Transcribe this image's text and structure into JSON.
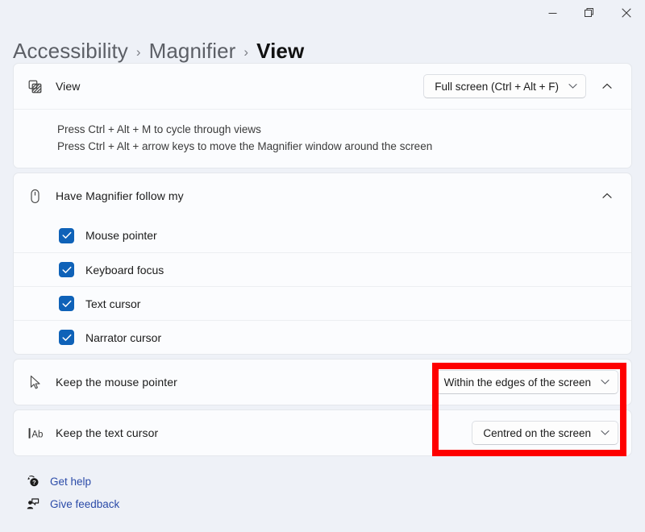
{
  "window": {
    "controls": [
      {
        "name": "minimize",
        "label": "Minimize"
      },
      {
        "name": "maximize",
        "label": "Restore"
      },
      {
        "name": "close",
        "label": "Close"
      }
    ]
  },
  "breadcrumb": {
    "items": [
      {
        "label": "Accessibility",
        "current": false
      },
      {
        "label": "Magnifier",
        "current": false
      },
      {
        "label": "View",
        "current": true
      }
    ],
    "separator": "›"
  },
  "view_card": {
    "icon": "view-layers-icon",
    "label": "View",
    "dropdown_value": "Full screen (Ctrl + Alt + F)",
    "collapse_icon": "chevron-up-icon",
    "description_lines": [
      "Press Ctrl + Alt + M to cycle through views",
      "Press Ctrl + Alt + arrow keys to move the Magnifier window around the screen"
    ]
  },
  "follow_card": {
    "icon": "mouse-icon",
    "label": "Have Magnifier follow my",
    "collapse_icon": "chevron-up-icon",
    "checkboxes": [
      {
        "label": "Mouse pointer",
        "checked": true
      },
      {
        "label": "Keyboard focus",
        "checked": true
      },
      {
        "label": "Text cursor",
        "checked": true
      },
      {
        "label": "Narrator cursor",
        "checked": true
      }
    ]
  },
  "pointer_card": {
    "icon": "mouse-pointer-icon",
    "label": "Keep the mouse pointer",
    "dropdown_value": "Within the edges of the screen"
  },
  "text_cursor_card": {
    "icon": "text-cursor-icon",
    "label": "Keep the text cursor",
    "dropdown_value": "Centred on the screen"
  },
  "footer": {
    "links": [
      {
        "label": "Get help",
        "icon": "help-icon"
      },
      {
        "label": "Give feedback",
        "icon": "feedback-icon"
      }
    ]
  },
  "colors": {
    "page_background": "#eef1f7",
    "card_background": "#fbfcfe",
    "accent_checkbox": "#0f62b8",
    "link": "#2b4ba8",
    "annotation": "#fe0000"
  }
}
